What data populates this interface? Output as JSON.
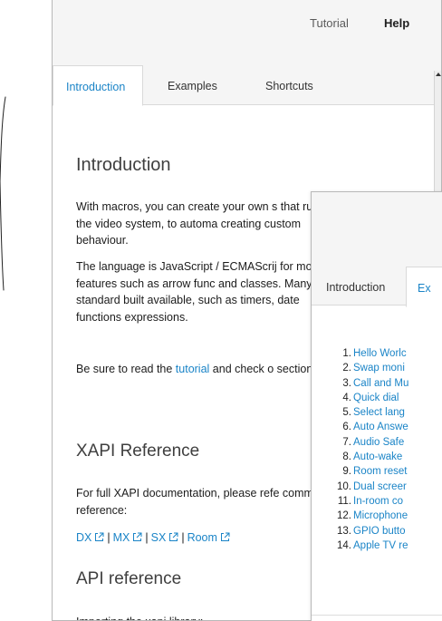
{
  "header": {
    "tutorial_link": "Tutorial",
    "help_link": "Help"
  },
  "tabs": [
    {
      "label": "Introduction",
      "active": true
    },
    {
      "label": "Examples",
      "active": false
    },
    {
      "label": "Shortcuts",
      "active": false
    }
  ],
  "intro": {
    "heading": "Introduction",
    "paragraph1": "With macros, you can create your own s that run on the video system, to automa creating custom behaviour.",
    "paragraph2": "The language is JavaScript / ECMAScrij for modern features such as arrow func and classes. Many of the standard built available, such as timers, date functions expressions.",
    "paragraph3_before": "Be sure to read the ",
    "paragraph3_link": "tutorial",
    "paragraph3_after": " and check o section."
  },
  "xapi": {
    "heading": "XAPI Reference",
    "paragraph": "For full XAPI documentation, please refe command reference:",
    "links": [
      "DX",
      "MX",
      "SX",
      "Room"
    ],
    "separator": "|"
  },
  "api": {
    "heading": "API reference",
    "importing_label": "Importing the xapi library:"
  },
  "front_window": {
    "tabs": [
      {
        "label": "Introduction",
        "active": false
      },
      {
        "label": "Ex",
        "active": true
      }
    ],
    "examples": [
      {
        "num": "1.",
        "label": "Hello Worlc"
      },
      {
        "num": "2.",
        "label": "Swap moni"
      },
      {
        "num": "3.",
        "label": "Call and Mu"
      },
      {
        "num": "4.",
        "label": "Quick dial"
      },
      {
        "num": "5.",
        "label": "Select lang"
      },
      {
        "num": "6.",
        "label": "Auto Answe"
      },
      {
        "num": "7.",
        "label": "Audio Safe"
      },
      {
        "num": "8.",
        "label": "Auto-wake"
      },
      {
        "num": "9.",
        "label": "Room reset"
      },
      {
        "num": "10.",
        "label": "Dual screer"
      },
      {
        "num": "11.",
        "label": "In-room co"
      },
      {
        "num": "12.",
        "label": "Microphone"
      },
      {
        "num": "13.",
        "label": "GPIO butto"
      },
      {
        "num": "14.",
        "label": "Apple TV re"
      }
    ]
  },
  "colors": {
    "link_blue": "#1a84c7",
    "header_bg": "#f5f5f5",
    "heading_gray": "#3f3f3f"
  },
  "icons": [
    "external-link-icon",
    "scroll-up-arrow-icon",
    "hand-drawn-arrow-icon"
  ]
}
